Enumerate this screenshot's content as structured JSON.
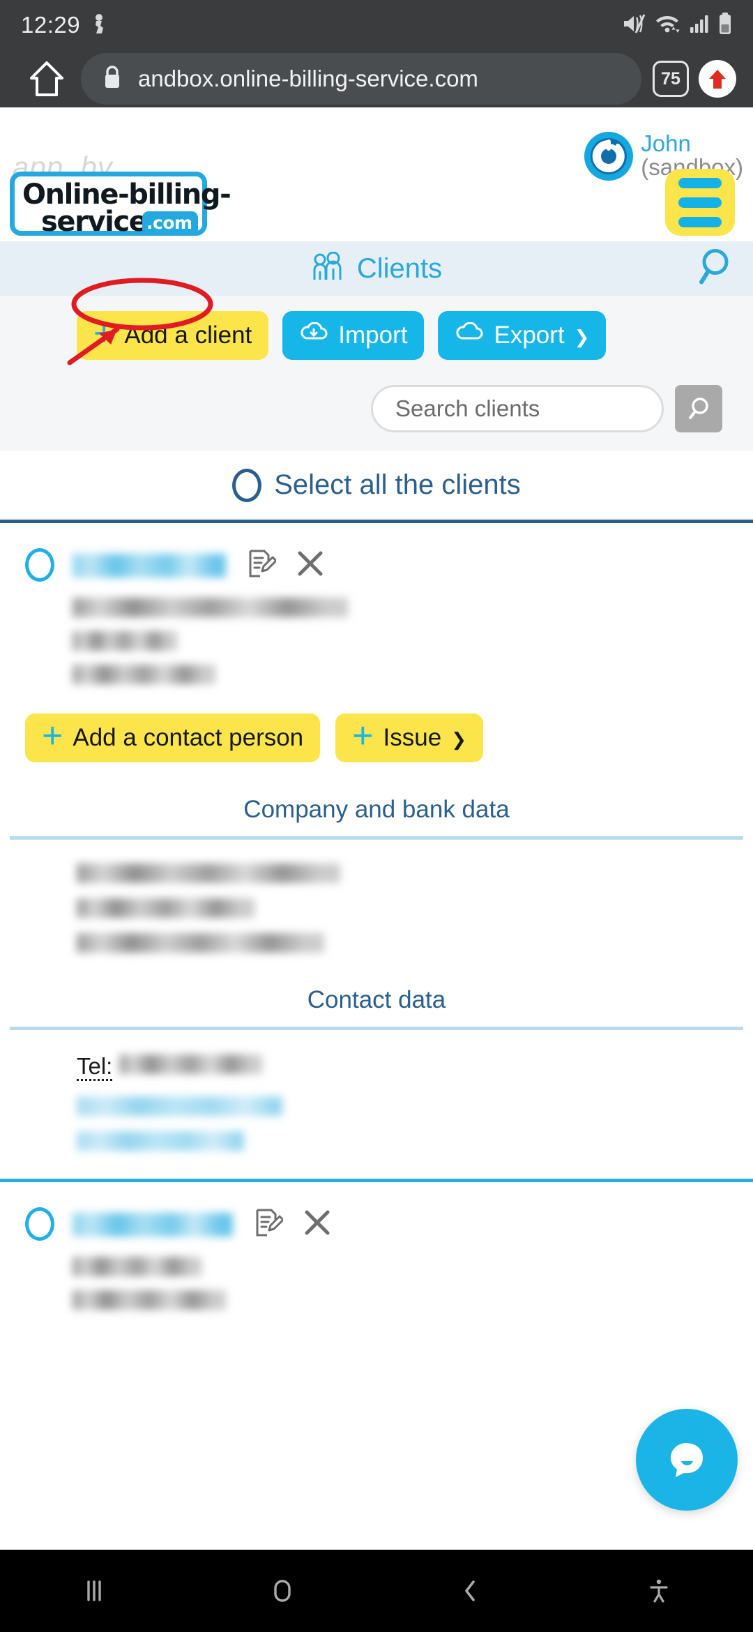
{
  "status_bar": {
    "time": "12:29",
    "icons": [
      "mute-icon",
      "wifi-icon",
      "cellular-signal-icon",
      "battery-icon"
    ]
  },
  "browser": {
    "home_icon": "home-icon",
    "lock_icon": "lock-icon",
    "url": "andbox.online-billing-service.com",
    "tab_count": "75",
    "update_icon": "update-arrow-icon"
  },
  "app_header": {
    "app_by_label": "app_by",
    "logo": {
      "line1": "Online-billing-",
      "line2": "service",
      "badge": ".com"
    },
    "user": {
      "name": "John",
      "environment": "(sandbox)",
      "avatar_icon": "power-avatar-icon"
    },
    "menu_icon": "hamburger-menu-icon"
  },
  "title_bar": {
    "icon": "clients-group-icon",
    "title": "Clients",
    "search_icon": "magnifier-icon"
  },
  "actions": {
    "add_client": {
      "label": "Add a client",
      "icon": "plus-icon"
    },
    "import": {
      "label": "Import",
      "icon": "cloud-download-icon"
    },
    "export": {
      "label": "Export",
      "icon": "cloud-upload-icon",
      "caret": "chevron-down-icon"
    }
  },
  "search": {
    "placeholder": "Search clients",
    "value": "",
    "button_icon": "magnifier-icon"
  },
  "select_all": {
    "label": "Select all the clients",
    "radio_icon": "radio-unchecked-icon"
  },
  "clients": [
    {
      "name_redacted": "",
      "edit_icon": "edit-document-icon",
      "delete_icon": "close-x-icon",
      "lines": [
        "",
        "",
        ""
      ],
      "buttons": {
        "add_contact": {
          "label": "Add a contact person",
          "icon": "plus-icon"
        },
        "issue": {
          "label": "Issue",
          "icon": "plus-icon",
          "caret": "chevron-down-icon"
        }
      },
      "sections": [
        {
          "title": "Company and bank data",
          "lines": [
            "",
            "",
            ""
          ]
        },
        {
          "title": "Contact data",
          "tel_label": "Tel:",
          "tel_value": "",
          "links": [
            "",
            ""
          ]
        }
      ]
    },
    {
      "name_redacted": "",
      "edit_icon": "edit-document-icon",
      "delete_icon": "close-x-icon",
      "lines": [
        "",
        ""
      ]
    }
  ],
  "chat": {
    "icon": "chat-bubble-icon"
  },
  "nav_bar": {
    "recents_icon": "recents-icon",
    "home_icon": "home-circle-icon",
    "back_icon": "back-chevron-icon",
    "accessibility_icon": "accessibility-icon"
  },
  "annotations": {
    "highlight_target": "Add a client",
    "ellipse_color": "#e01b22",
    "arrow_color": "#e01b22"
  },
  "colors": {
    "accent_blue": "#17b6e8",
    "accent_yellow": "#fbe54a",
    "deep_blue": "#2b5f8e",
    "status_bar": "#3a3c3e"
  }
}
